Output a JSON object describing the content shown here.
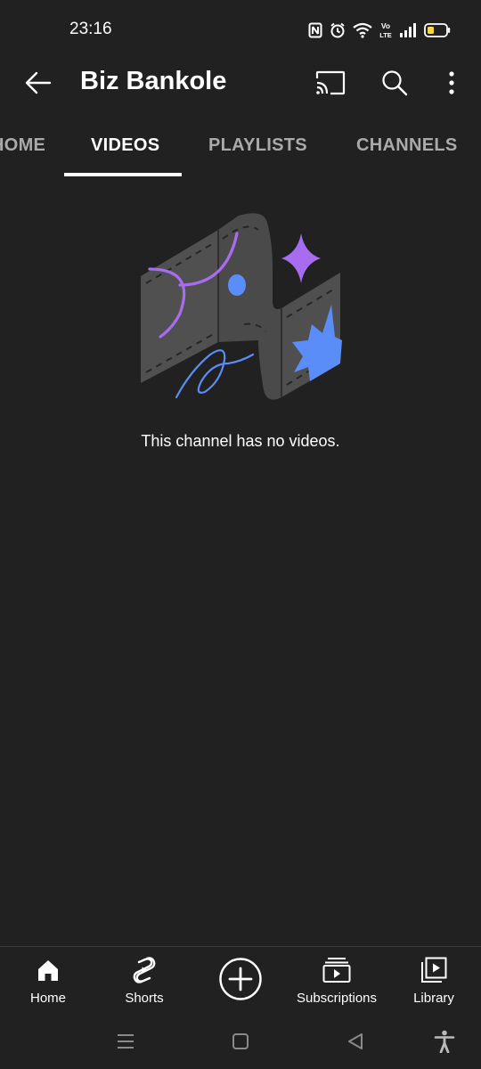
{
  "status_bar": {
    "time": "23:16",
    "icons": [
      "nfc-icon",
      "alarm-icon",
      "wifi-icon",
      "volte-icon",
      "signal-icon",
      "battery-icon"
    ],
    "volte_text": "Vo LTE"
  },
  "app_bar": {
    "title": "Biz Bankole",
    "icons": [
      "back-arrow-icon",
      "cast-icon",
      "search-icon",
      "more-vert-icon"
    ]
  },
  "tabs": [
    {
      "label": "HOME",
      "active": false
    },
    {
      "label": "VIDEOS",
      "active": true
    },
    {
      "label": "PLAYLISTS",
      "active": false
    },
    {
      "label": "CHANNELS",
      "active": false
    }
  ],
  "empty_state": {
    "message": "This channel has no videos."
  },
  "bottom_nav": [
    {
      "label": "Home",
      "icon": "home-icon"
    },
    {
      "label": "Shorts",
      "icon": "shorts-icon"
    },
    {
      "label": "",
      "icon": "create-icon"
    },
    {
      "label": "Subscriptions",
      "icon": "subscriptions-icon"
    },
    {
      "label": "Library",
      "icon": "library-icon"
    }
  ],
  "system_nav": {
    "icons": [
      "menu-icon",
      "home-square-icon",
      "back-triangle-icon",
      "accessibility-icon"
    ]
  },
  "colors": {
    "background": "#212121",
    "text": "#ffffff",
    "tab_inactive": "#aaaaaa",
    "illustration_purple": "#a86cf0",
    "illustration_blue": "#5b8df8"
  }
}
